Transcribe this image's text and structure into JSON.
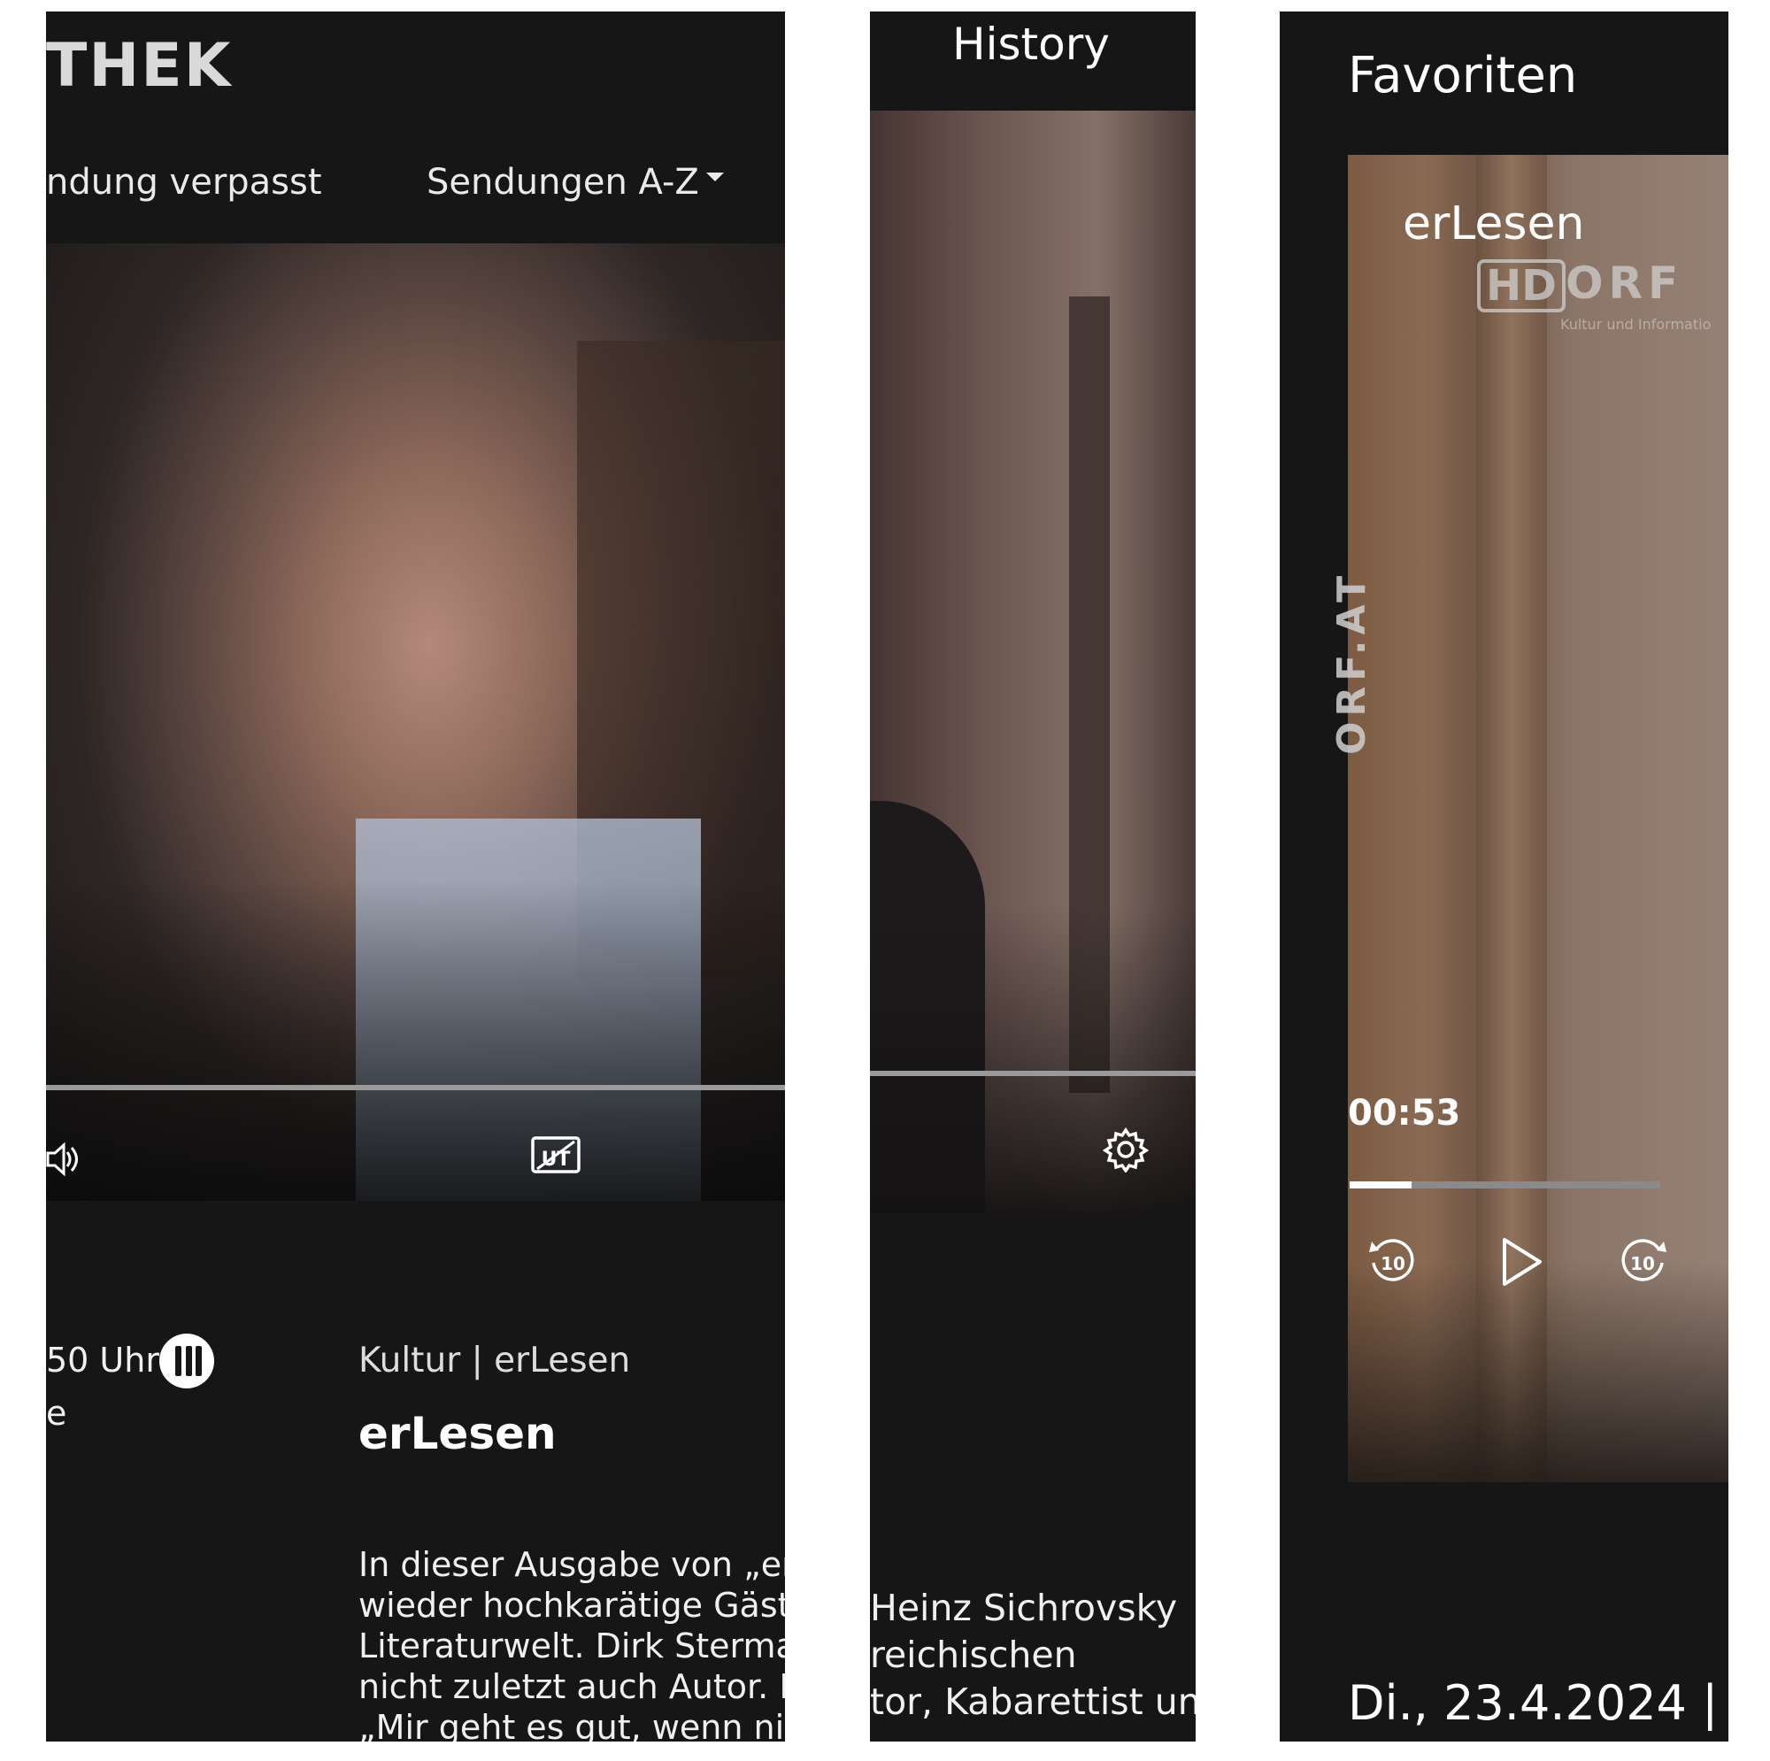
{
  "panel_left": {
    "logo": "THEK",
    "nav": {
      "missed_label": "ndung verpasst",
      "az_label": "Sendungen A-Z"
    },
    "player": {
      "volume_icon": "volume-icon",
      "subtitle_icon": "subtitles-icon"
    },
    "meta": {
      "time": "50 Uhr",
      "channel_badge": "orf3-logo",
      "subline": "e"
    },
    "category": "Kultur | erLesen",
    "title": "erLesen",
    "description_lines": [
      "In dieser Ausgabe von „erle",
      "wieder hochkarätige Gäste",
      "Literaturwelt. Dirk Sterman",
      "nicht zuletzt auch Autor. In",
      "„Mir geht es gut, wenn nich"
    ]
  },
  "panel_middle": {
    "heading": "History",
    "player": {
      "settings_icon": "gear-icon"
    },
    "description_lines": [
      "Heinz Sichrovsky",
      "reichischen",
      "tor, Kabarettist un"
    ]
  },
  "panel_right": {
    "heading": "Favoriten",
    "player": {
      "show_label": "erLesen",
      "hd_badge": "HD",
      "channel_logo": "ORF",
      "channel_logo_sub": "Kultur und Informatio",
      "watermark": "ORF.AT",
      "time": "00:53",
      "progress_fraction": 0.2,
      "controls": [
        "rewind-10-icon",
        "play-icon",
        "forward-10-icon"
      ]
    },
    "date": "Di., 23.4.2024  |"
  }
}
